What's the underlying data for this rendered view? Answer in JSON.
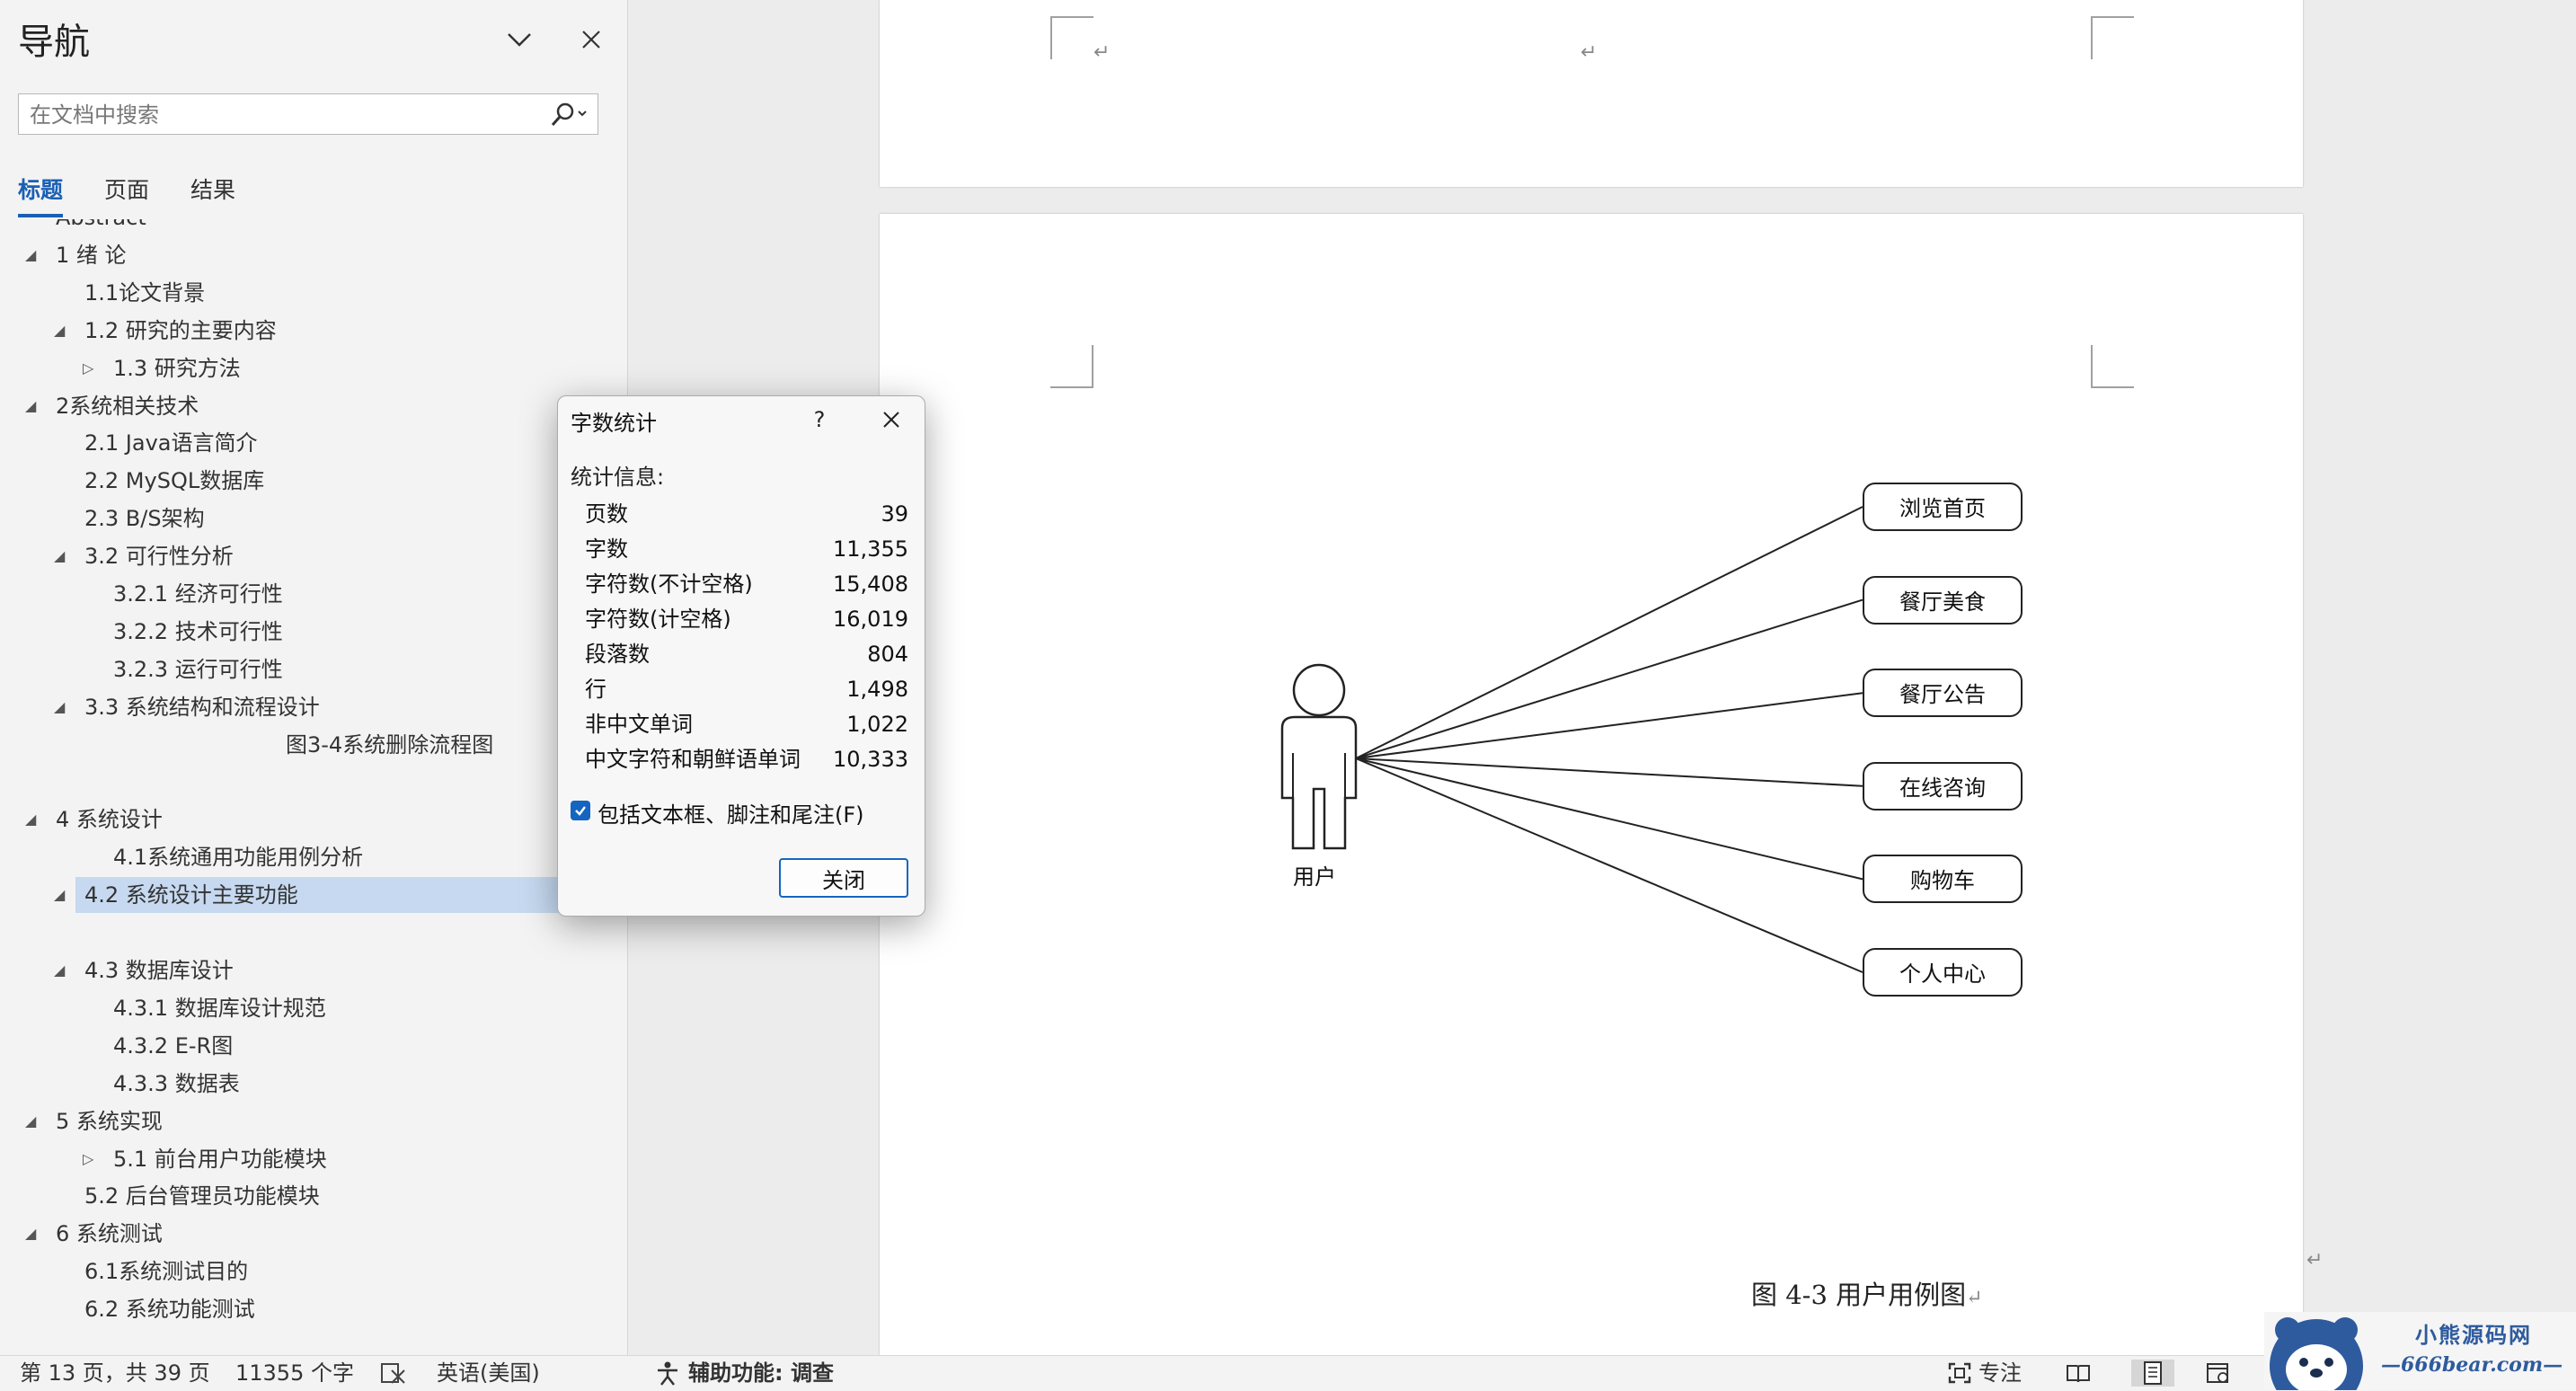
{
  "nav": {
    "title": "导航",
    "search_placeholder": "在文档中搜索",
    "tabs": [
      "标题",
      "页面",
      "结果"
    ],
    "headings": [
      {
        "text": "Abstract",
        "level": 1,
        "arrow": ""
      },
      {
        "text": "1 绪  论",
        "level": 1,
        "arrow": "expanded"
      },
      {
        "text": "1.1论文背景",
        "level": 2,
        "arrow": ""
      },
      {
        "text": "1.2 研究的主要内容",
        "level": 2,
        "arrow": "expanded"
      },
      {
        "text": "1.3 研究方法",
        "level": 3,
        "arrow": "collapsed"
      },
      {
        "text": "2系统相关技术",
        "level": 1,
        "arrow": "expanded"
      },
      {
        "text": "2.1 Java语言简介",
        "level": 2,
        "arrow": ""
      },
      {
        "text": "2.2  MySQL数据库",
        "level": 2,
        "arrow": ""
      },
      {
        "text": "2.3 B/S架构",
        "level": 2,
        "arrow": ""
      },
      {
        "text": "3.2 可行性分析",
        "level": 2,
        "arrow": "expanded"
      },
      {
        "text": "3.2.1 经济可行性",
        "level": 3,
        "arrow": ""
      },
      {
        "text": "3.2.2 技术可行性",
        "level": 3,
        "arrow": ""
      },
      {
        "text": "3.2.3 运行可行性",
        "level": 3,
        "arrow": ""
      },
      {
        "text": "3.3 系统结构和流程设计",
        "level": 2,
        "arrow": "expanded"
      },
      {
        "text": "图3-4系统删除流程图",
        "level": 5,
        "arrow": ""
      },
      {
        "text": "",
        "level": 1,
        "arrow": ""
      },
      {
        "text": "4 系统设计",
        "level": 1,
        "arrow": "expanded"
      },
      {
        "text": "4.1系统通用功能用例分析",
        "level": 3,
        "arrow": ""
      },
      {
        "text": "4.2 系统设计主要功能",
        "level": 2,
        "arrow": "expanded",
        "selected": true
      },
      {
        "text": "",
        "level": 1,
        "arrow": ""
      },
      {
        "text": "4.3 数据库设计",
        "level": 2,
        "arrow": "expanded"
      },
      {
        "text": "4.3.1 数据库设计规范",
        "level": 3,
        "arrow": ""
      },
      {
        "text": "4.3.2 E-R图",
        "level": 3,
        "arrow": ""
      },
      {
        "text": "4.3.3 数据表",
        "level": 3,
        "arrow": ""
      },
      {
        "text": "5 系统实现",
        "level": 1,
        "arrow": "expanded"
      },
      {
        "text": "5.1 前台用户功能模块",
        "level": 3,
        "arrow": "collapsed"
      },
      {
        "text": "5.2 后台管理员功能模块",
        "level": 2,
        "arrow": ""
      },
      {
        "text": "6 系统测试",
        "level": 1,
        "arrow": "expanded"
      },
      {
        "text": "6.1系统测试目的",
        "level": 2,
        "arrow": ""
      },
      {
        "text": "6.2 系统功能测试",
        "level": 2,
        "arrow": ""
      }
    ]
  },
  "dialog": {
    "title": "字数统计",
    "help": "?",
    "section": "统计信息:",
    "stats": [
      {
        "label": "页数",
        "value": "39"
      },
      {
        "label": "字数",
        "value": "11,355"
      },
      {
        "label": "字符数(不计空格)",
        "value": "15,408"
      },
      {
        "label": "字符数(计空格)",
        "value": "16,019"
      },
      {
        "label": "段落数",
        "value": "804"
      },
      {
        "label": "行",
        "value": "1,498"
      },
      {
        "label": "非中文单词",
        "value": "1,022"
      },
      {
        "label": "中文字符和朝鲜语单词",
        "value": "10,333"
      }
    ],
    "checkbox_label": "包括文本框、脚注和尾注(F)",
    "checkbox_checked": true,
    "close_label": "关闭"
  },
  "diagram": {
    "actor": "用户",
    "use_cases": [
      "浏览首页",
      "餐厅美食",
      "餐厅公告",
      "在线咨询",
      "购物车",
      "个人中心"
    ],
    "caption": "图 4-3 用户用例图"
  },
  "statusbar": {
    "page_info": "第 13 页，共 39 页",
    "word_count": "11355 个字",
    "language": "英语(美国)",
    "accessibility": "辅助功能: 调查",
    "focus": "专注"
  },
  "watermark": {
    "line1": "小熊源码网",
    "line2": "—666bear.com—"
  },
  "colors": {
    "accent": "#1565c0",
    "selection": "#c6d9f0",
    "nav_background": "#f3f3f3"
  }
}
